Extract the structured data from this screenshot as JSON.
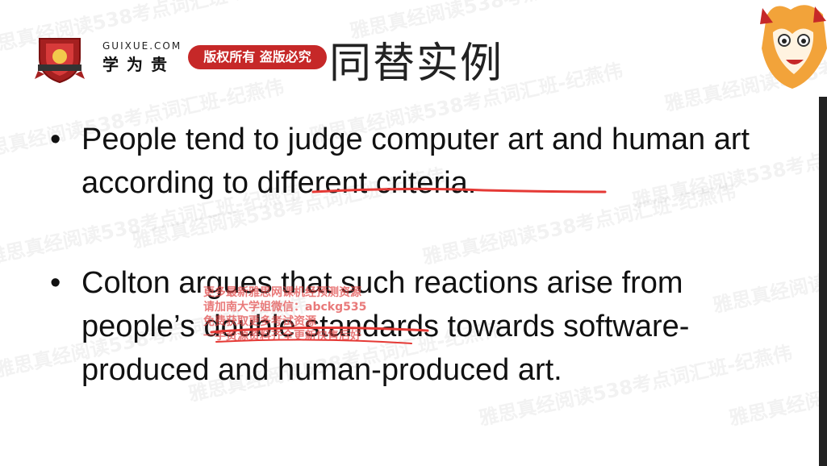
{
  "header": {
    "logo_domain": "GUIXUE.COM",
    "logo_name": "学为贵",
    "copyright_badge": "版权所有 盗版必究",
    "slide_title": "同替实例"
  },
  "watermark": {
    "text": "雅思真经阅读538考点词汇班-纪燕伟"
  },
  "bullets": [
    {
      "marker": "•",
      "before": "People tend to judge computer art and human art according to ",
      "underlined": "different criteria.",
      "after": ""
    },
    {
      "marker": "•",
      "before": "Colton argues that such reactions arise from people’s ",
      "underlined": "double standard",
      "after": "s towards software-produced and human-produced art."
    }
  ],
  "overlay_ad": {
    "lines": [
      "更多最新雅思网课机经预测资源",
      "请加南大学姐微信：abckg535",
      "免费获取更多考试资源",
      "一手资源资料齐全更新快售后好"
    ]
  },
  "colors": {
    "badge_red": "#c62828",
    "annotation_red": "#e53935",
    "text": "#111111"
  },
  "icons": [
    "crest-logo-icon",
    "fox-mascot-icon"
  ]
}
